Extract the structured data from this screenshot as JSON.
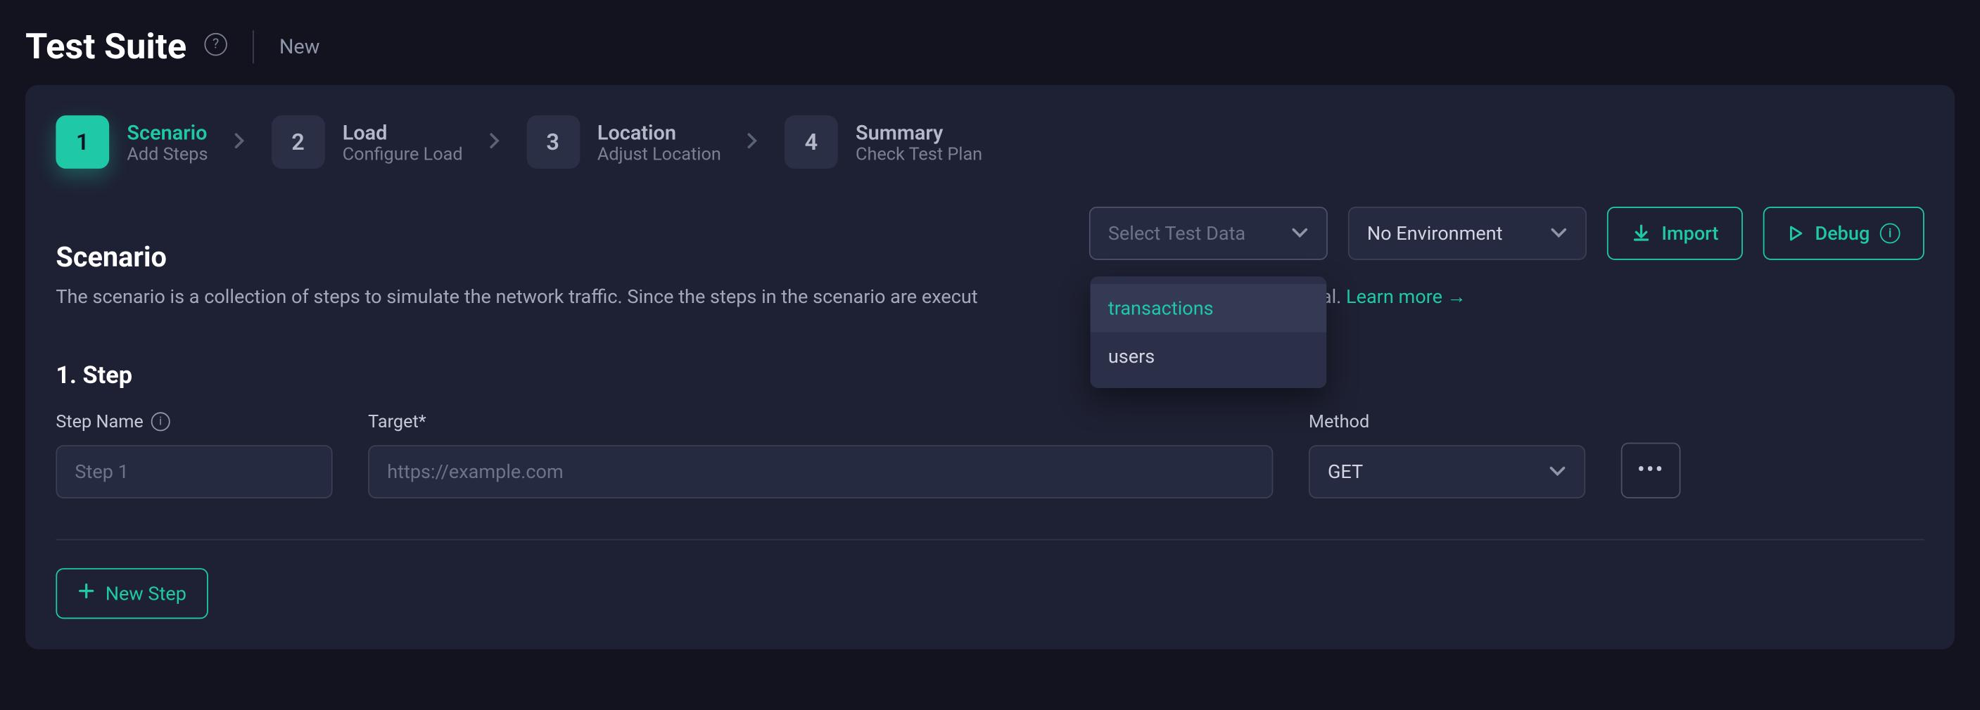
{
  "header": {
    "title": "Test Suite",
    "new_link": "New"
  },
  "stepper": [
    {
      "num": "1",
      "title": "Scenario",
      "sub": "Add Steps",
      "active": true
    },
    {
      "num": "2",
      "title": "Load",
      "sub": "Configure Load",
      "active": false
    },
    {
      "num": "3",
      "title": "Location",
      "sub": "Adjust Location",
      "active": false
    },
    {
      "num": "4",
      "title": "Summary",
      "sub": "Check Test Plan",
      "active": false
    }
  ],
  "toolbar": {
    "test_data_placeholder": "Select Test Data",
    "test_data_options": [
      "transactions",
      "users"
    ],
    "env_value": "No Environment",
    "import_label": "Import",
    "debug_label": "Debug"
  },
  "scenario": {
    "title": "Scenario",
    "desc_before": "The scenario is a collection of steps to simulate the network traffic. Since the steps in the scenario are execut",
    "desc_after": "r is crucial. ",
    "learn_more": "Learn more →"
  },
  "step1": {
    "heading": "1. Step",
    "name_label": "Step Name",
    "name_placeholder": "Step 1",
    "target_label": "Target*",
    "target_placeholder": "https://example.com",
    "method_label": "Method",
    "method_value": "GET"
  },
  "new_step": {
    "label": "New Step"
  }
}
